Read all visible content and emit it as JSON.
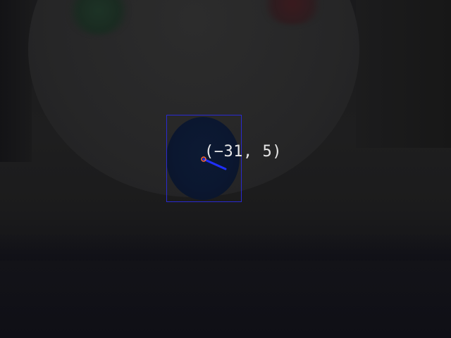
{
  "overlay": {
    "coordinate_label": "(−31, 5)",
    "box_color": "#2a2ad0",
    "vector_color": "#2030ff",
    "center_marker_color": "#ff6a3a",
    "label_color": "#e8e8e8"
  },
  "scene": {
    "background_color": "#1e1e1f",
    "ball_color": "#0b1730"
  }
}
